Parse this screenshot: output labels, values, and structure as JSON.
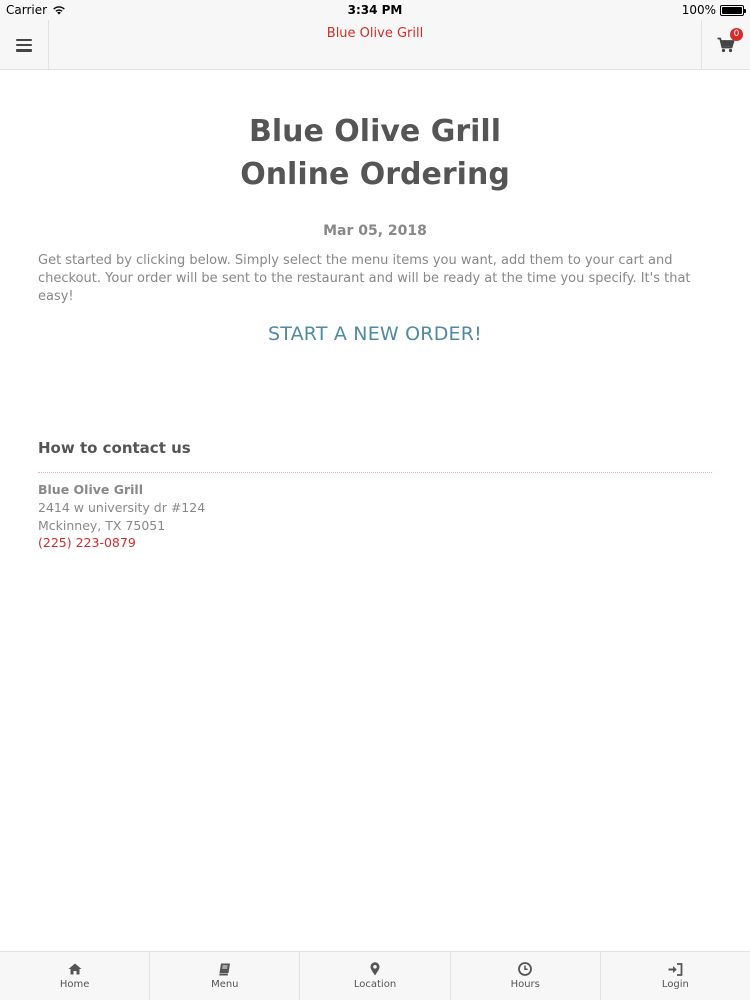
{
  "status_bar": {
    "carrier": "Carrier",
    "time": "3:34 PM",
    "battery": "100%"
  },
  "nav": {
    "title": "Blue Olive Grill",
    "cart_count": "0"
  },
  "main": {
    "heading_line1": "Blue Olive Grill",
    "heading_line2": "Online Ordering",
    "date": "Mar 05, 2018",
    "intro": "Get started by clicking below. Simply select the menu items you want, add them to your cart and checkout. Your order will be sent to the restaurant and will be ready at the time you specify. It's that easy!",
    "start_link": "START A NEW ORDER!"
  },
  "contact": {
    "heading": "How to contact us",
    "name": "Blue Olive Grill",
    "address_line1": "2414 w university dr #124",
    "address_line2": "Mckinney, TX 75051",
    "phone": "(225) 223-0879"
  },
  "tabs": [
    {
      "label": "Home",
      "icon": "home-icon"
    },
    {
      "label": "Menu",
      "icon": "book-icon"
    },
    {
      "label": "Location",
      "icon": "map-pin-icon"
    },
    {
      "label": "Hours",
      "icon": "clock-icon"
    },
    {
      "label": "Login",
      "icon": "login-icon"
    }
  ],
  "colors": {
    "accent_red": "#d62b2b",
    "link_blue": "#4f8aa4",
    "text_gray": "#888888",
    "heading_gray": "#555555"
  }
}
